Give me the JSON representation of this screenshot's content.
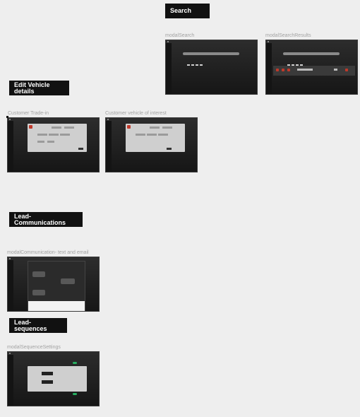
{
  "sections": {
    "search": "Search",
    "edit_vehicle": "Edit Vehicle details",
    "lead_communications": "Lead-Communications",
    "lead_sequences": "Lead- sequences"
  },
  "frames": {
    "modal_search": "modalSearch",
    "modal_search_results": "modalSearchResults",
    "customer_trade_in": "Customer Trade-in",
    "customer_vehicle_interest": "Customer vehicle of interest",
    "modal_communication": "modalCommunication- text and email",
    "modal_sequence_settings": "modalSequenceSettings"
  },
  "colors": {
    "canvas": "#eeeeee",
    "label_bg": "#111111",
    "frame_bg": "#1f1f1f",
    "accent_red": "#c0392b",
    "toggle_green": "#27ae60"
  }
}
